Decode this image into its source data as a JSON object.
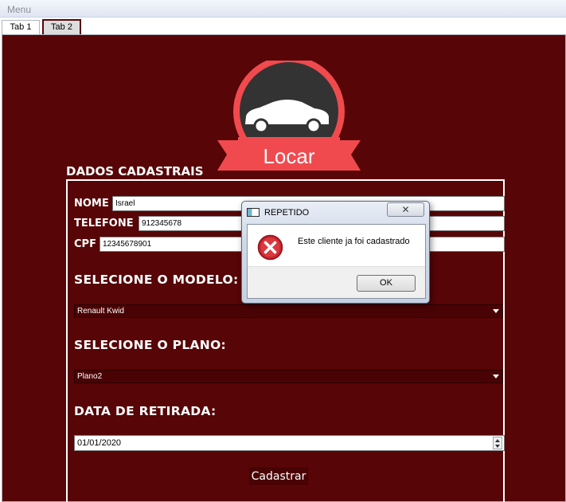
{
  "menubar": {
    "menu_label": "Menu"
  },
  "tabs": [
    {
      "label": "Tab 1"
    },
    {
      "label": "Tab 2"
    }
  ],
  "logo": {
    "text": "Locar"
  },
  "dados": {
    "title": "DADOS CADASTRAIS",
    "nome_label": "NOME",
    "nome_value": "Israel",
    "telefone_label": "TELEFONE",
    "telefone_value": "912345678",
    "cpf_label": "CPF",
    "cpf_value": "12345678901"
  },
  "modelo": {
    "label": "SELECIONE O MODELO:",
    "selected": "Renault Kwid"
  },
  "plano": {
    "label": "SELECIONE O PLANO:",
    "selected": "Plano2"
  },
  "retirada": {
    "label": "DATA DE RETIRADA:",
    "value": "01/01/2020"
  },
  "submit": {
    "label": "Cadastrar"
  },
  "dialog": {
    "title": "REPETIDO",
    "close_symbol": "✕",
    "message": "Este cliente ja foi cadastrado",
    "ok_label": "OK"
  },
  "colors": {
    "panel_bg": "#570506",
    "logo_red": "#f04a4f",
    "logo_dark": "#333333"
  }
}
